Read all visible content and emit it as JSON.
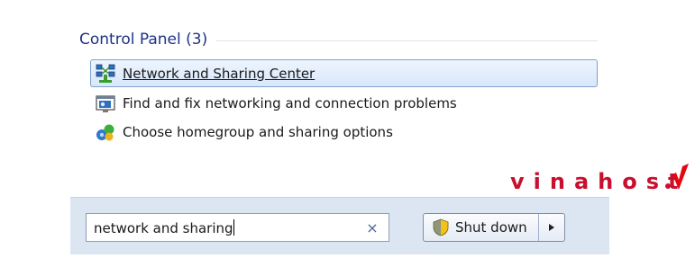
{
  "control_panel": {
    "header": "Control Panel (3)",
    "results": [
      {
        "label": "Network and Sharing Center",
        "icon": "network-sharing-center-icon",
        "selected": true
      },
      {
        "label": "Find and fix networking and connection problems",
        "icon": "troubleshoot-icon",
        "selected": false
      },
      {
        "label": "Choose homegroup and sharing options",
        "icon": "homegroup-icon",
        "selected": false
      }
    ]
  },
  "search": {
    "value": "network and sharing",
    "clear_glyph": "×"
  },
  "power": {
    "shutdown_label": "Shut down",
    "arrow_glyph": "▸"
  },
  "watermark": {
    "text": "vinahost"
  },
  "colors": {
    "header_text": "#1e3287",
    "selection_border": "#7da2ce",
    "bottom_band": "#dce6f3",
    "watermark_red": "#c8102e"
  }
}
